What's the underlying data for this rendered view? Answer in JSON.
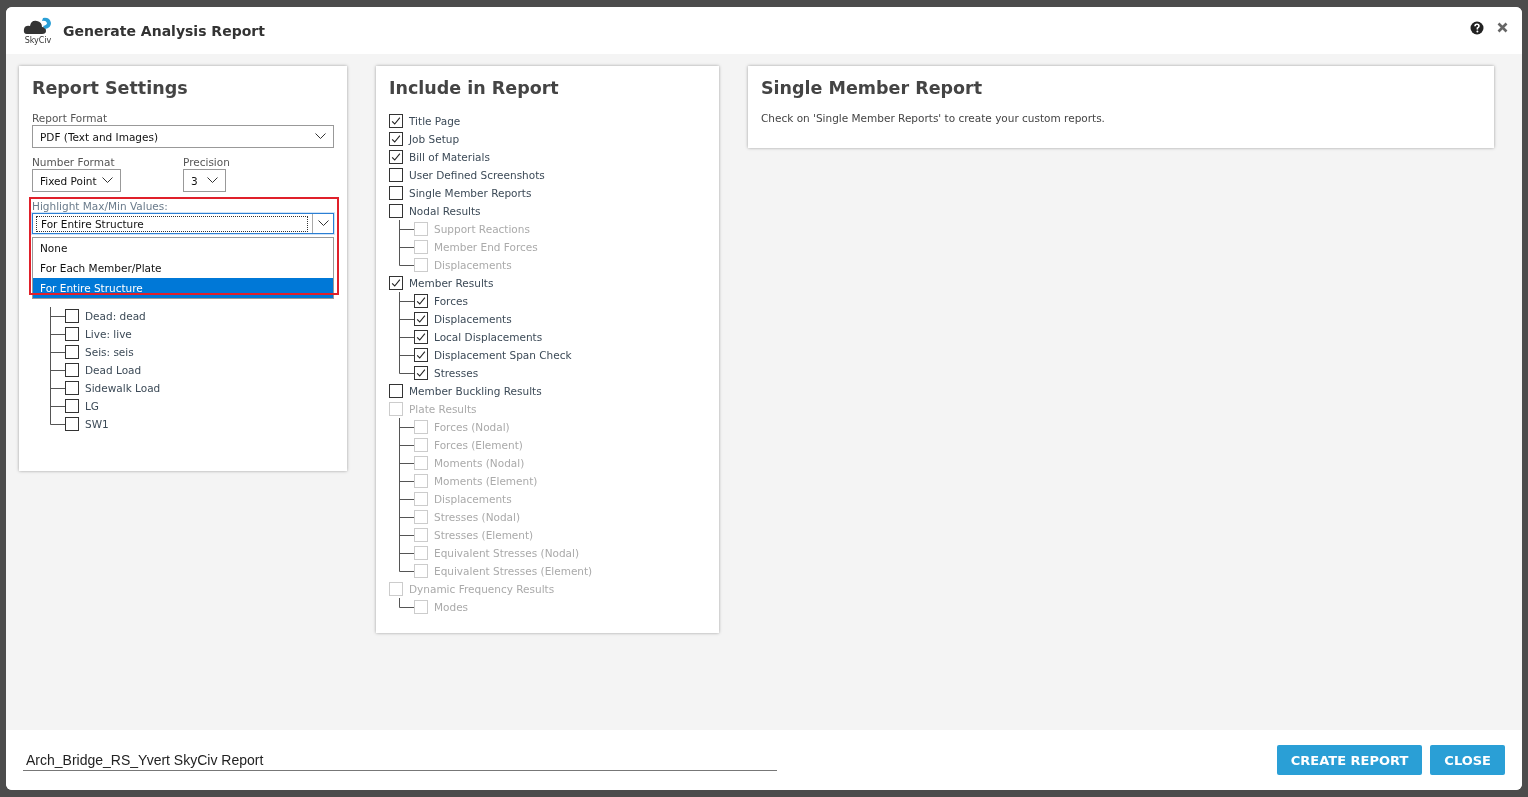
{
  "window": {
    "title": "Generate Analysis Report",
    "logo_text": "SkyCiv"
  },
  "report_settings": {
    "title": "Report Settings",
    "report_format": {
      "label": "Report Format",
      "value": "PDF (Text and Images)"
    },
    "number_format": {
      "label": "Number Format",
      "value": "Fixed Point"
    },
    "precision": {
      "label": "Precision",
      "value": "3"
    },
    "highlight": {
      "label": "Highlight Max/Min Values:",
      "value": "For Entire Structure",
      "expanded": true,
      "options": [
        {
          "label": "None",
          "selected": false
        },
        {
          "label": "For Each Member/Plate",
          "selected": false
        },
        {
          "label": "For Entire Structure",
          "selected": true
        }
      ]
    },
    "load_cases": [
      {
        "label": "Dead: dead",
        "checked": false
      },
      {
        "label": "Live: live",
        "checked": false
      },
      {
        "label": "Seis: seis",
        "checked": false
      },
      {
        "label": "Dead Load",
        "checked": false
      },
      {
        "label": "Sidewalk Load",
        "checked": false
      },
      {
        "label": "LG",
        "checked": false
      },
      {
        "label": "SW1",
        "checked": false
      }
    ]
  },
  "include": {
    "title": "Include in Report",
    "items": [
      {
        "label": "Title Page",
        "checked": true,
        "disabled": false
      },
      {
        "label": "Job Setup",
        "checked": true,
        "disabled": false
      },
      {
        "label": "Bill of Materials",
        "checked": true,
        "disabled": false
      },
      {
        "label": "User Defined Screenshots",
        "checked": false,
        "disabled": false
      },
      {
        "label": "Single Member Reports",
        "checked": false,
        "disabled": false
      },
      {
        "label": "Nodal Results",
        "checked": false,
        "disabled": false,
        "children": [
          {
            "label": "Support Reactions",
            "checked": false,
            "disabled": true
          },
          {
            "label": "Member End Forces",
            "checked": false,
            "disabled": true
          },
          {
            "label": "Displacements",
            "checked": false,
            "disabled": true
          }
        ]
      },
      {
        "label": "Member Results",
        "checked": true,
        "disabled": false,
        "children": [
          {
            "label": "Forces",
            "checked": true,
            "disabled": false
          },
          {
            "label": "Displacements",
            "checked": true,
            "disabled": false
          },
          {
            "label": "Local Displacements",
            "checked": true,
            "disabled": false
          },
          {
            "label": "Displacement Span Check",
            "checked": true,
            "disabled": false
          },
          {
            "label": "Stresses",
            "checked": true,
            "disabled": false
          }
        ]
      },
      {
        "label": "Member Buckling Results",
        "checked": false,
        "disabled": false
      },
      {
        "label": "Plate Results",
        "checked": false,
        "disabled": true,
        "children": [
          {
            "label": "Forces (Nodal)",
            "checked": false,
            "disabled": true
          },
          {
            "label": "Forces (Element)",
            "checked": false,
            "disabled": true
          },
          {
            "label": "Moments (Nodal)",
            "checked": false,
            "disabled": true
          },
          {
            "label": "Moments (Element)",
            "checked": false,
            "disabled": true
          },
          {
            "label": "Displacements",
            "checked": false,
            "disabled": true
          },
          {
            "label": "Stresses (Nodal)",
            "checked": false,
            "disabled": true
          },
          {
            "label": "Stresses (Element)",
            "checked": false,
            "disabled": true
          },
          {
            "label": "Equivalent Stresses (Nodal)",
            "checked": false,
            "disabled": true
          },
          {
            "label": "Equivalent Stresses (Element)",
            "checked": false,
            "disabled": true
          }
        ]
      },
      {
        "label": "Dynamic Frequency Results",
        "checked": false,
        "disabled": true,
        "children": [
          {
            "label": "Modes",
            "checked": false,
            "disabled": true
          }
        ]
      }
    ]
  },
  "single_member": {
    "title": "Single Member Report",
    "text": "Check on 'Single Member Reports' to create your custom reports."
  },
  "footer": {
    "file_name": "Arch_Bridge_RS_Yvert SkyCiv Report",
    "buttons": [
      "CREATE REPORT",
      "CLOSE"
    ]
  }
}
